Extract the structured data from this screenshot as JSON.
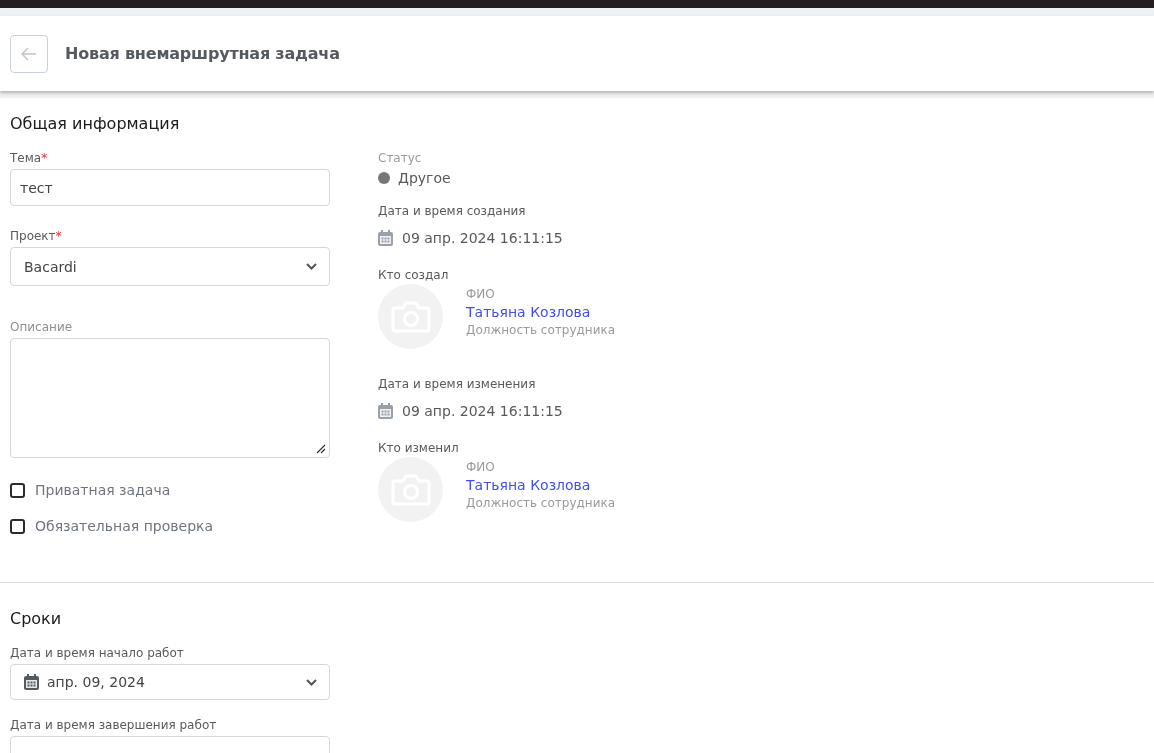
{
  "header": {
    "title": "Новая внемаршрутная задача"
  },
  "general": {
    "title": "Общая информация",
    "fields": [
      {
        "kind": "text",
        "label": "Тема",
        "mark": "*",
        "value": "тест"
      },
      {
        "kind": "select",
        "label": "Проект",
        "mark": "*",
        "value": "Bacardi"
      },
      {
        "kind": "textarea",
        "label": "Описание"
      }
    ],
    "checkboxes": [
      {
        "label": "Приватная задача",
        "checked": false
      },
      {
        "label": "Обязательная проверка",
        "checked": false
      }
    ]
  },
  "info": [
    {
      "kind": "status",
      "label": "Статус",
      "value": "Другое",
      "color": "#75777c"
    },
    {
      "kind": "date",
      "label": "Дата и время создания",
      "value": "09 апр. 2024 16:11:15"
    },
    {
      "kind": "person",
      "label": "Кто создал",
      "caption": "ФИО",
      "name": "Татьяна Козлова",
      "position": "Должность сотрудника"
    },
    {
      "kind": "date",
      "label": "Дата и время изменения",
      "value": "09 апр. 2024 16:11:15"
    },
    {
      "kind": "person",
      "label": "Кто изменил",
      "caption": "ФИО",
      "name": "Татьяна Козлова",
      "position": "Должность сотрудника"
    }
  ],
  "deadlines": {
    "title": "Сроки",
    "fields": [
      {
        "label": "Дата и время начало работ",
        "value": "апр. 09, 2024"
      },
      {
        "label": "Дата и время завершения работ"
      }
    ]
  }
}
